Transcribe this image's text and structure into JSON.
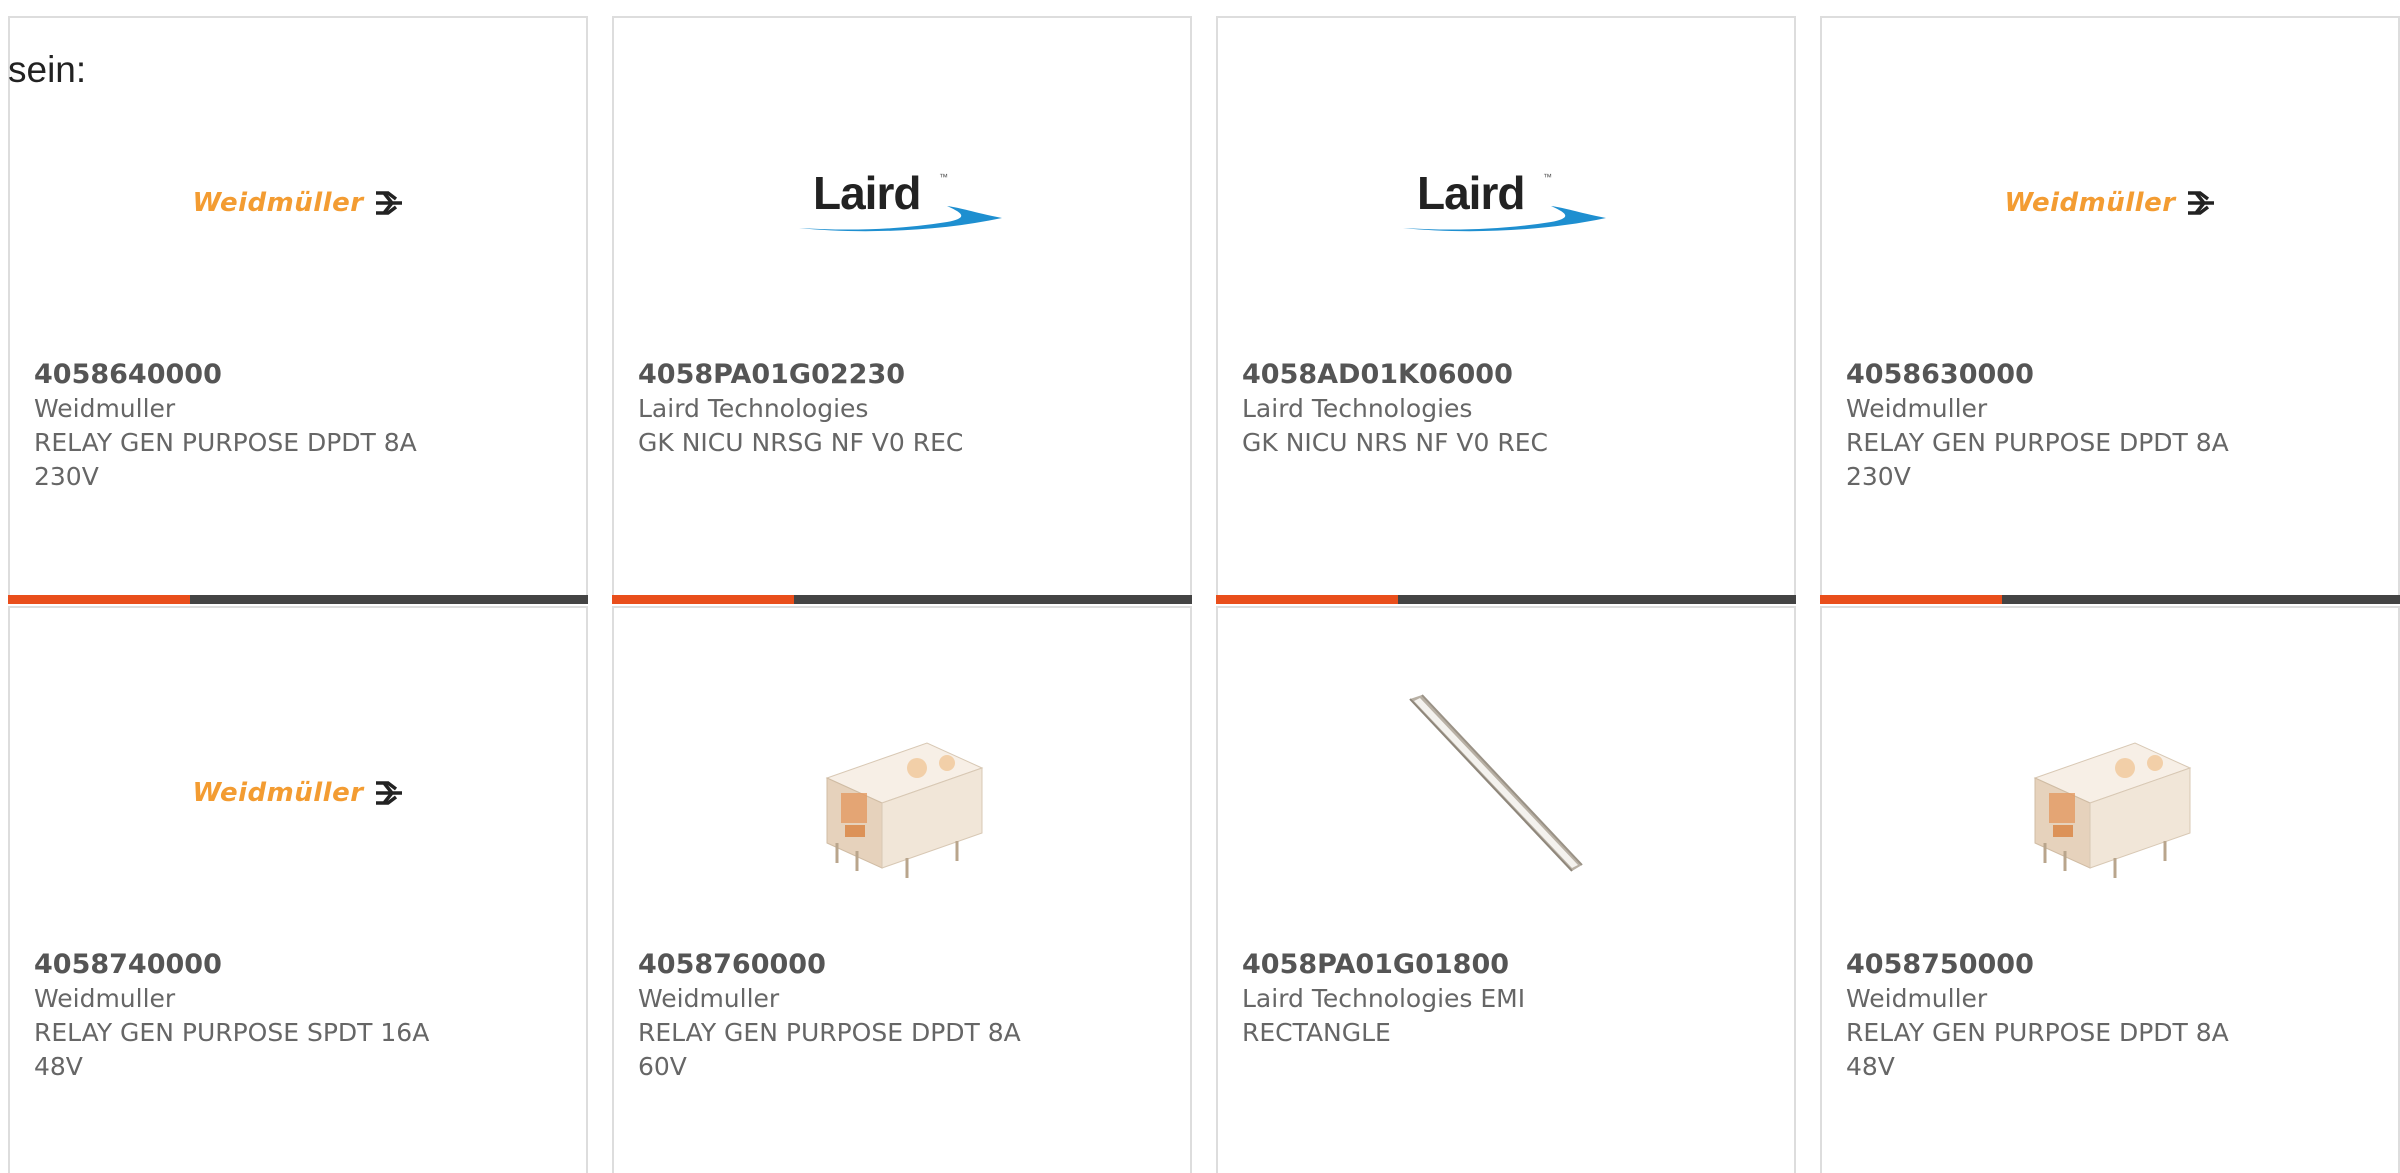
{
  "stray_text": "sein:",
  "colors": {
    "accent": "#e94e1b",
    "bar_dark": "#444444",
    "card_border": "#dddddd",
    "weidmuller_orange": "#f39c32",
    "laird_blue": "#1e8fd0"
  },
  "products": [
    {
      "part_number": "4058640000",
      "manufacturer": "Weidmuller",
      "description": "RELAY GEN PURPOSE DPDT 8A 230V",
      "image": "weidmuller-logo",
      "logo_text": "Weidmüller"
    },
    {
      "part_number": "4058PA01G02230",
      "manufacturer": "Laird Technologies",
      "description": "GK NICU NRSG NF V0 REC",
      "image": "laird-logo",
      "logo_text": "Laird",
      "logo_tm": "™"
    },
    {
      "part_number": "4058AD01K06000",
      "manufacturer": "Laird Technologies",
      "description": "GK NICU NRS NF V0 REC",
      "image": "laird-logo",
      "logo_text": "Laird",
      "logo_tm": "™"
    },
    {
      "part_number": "4058630000",
      "manufacturer": "Weidmuller",
      "description": "RELAY GEN PURPOSE DPDT 8A 230V",
      "image": "weidmuller-logo",
      "logo_text": "Weidmüller"
    },
    {
      "part_number": "4058740000",
      "manufacturer": "Weidmuller",
      "description": "RELAY GEN PURPOSE SPDT 16A 48V",
      "image": "weidmuller-logo",
      "logo_text": "Weidmüller"
    },
    {
      "part_number": "4058760000",
      "manufacturer": "Weidmuller",
      "description": "RELAY GEN PURPOSE DPDT 8A 60V",
      "image": "relay-photo"
    },
    {
      "part_number": "4058PA01G01800",
      "manufacturer": "Laird Technologies EMI",
      "description": "RECTANGLE",
      "image": "gasket-photo"
    },
    {
      "part_number": "4058750000",
      "manufacturer": "Weidmuller",
      "description": "RELAY GEN PURPOSE DPDT 8A 48V",
      "image": "relay-photo"
    }
  ]
}
